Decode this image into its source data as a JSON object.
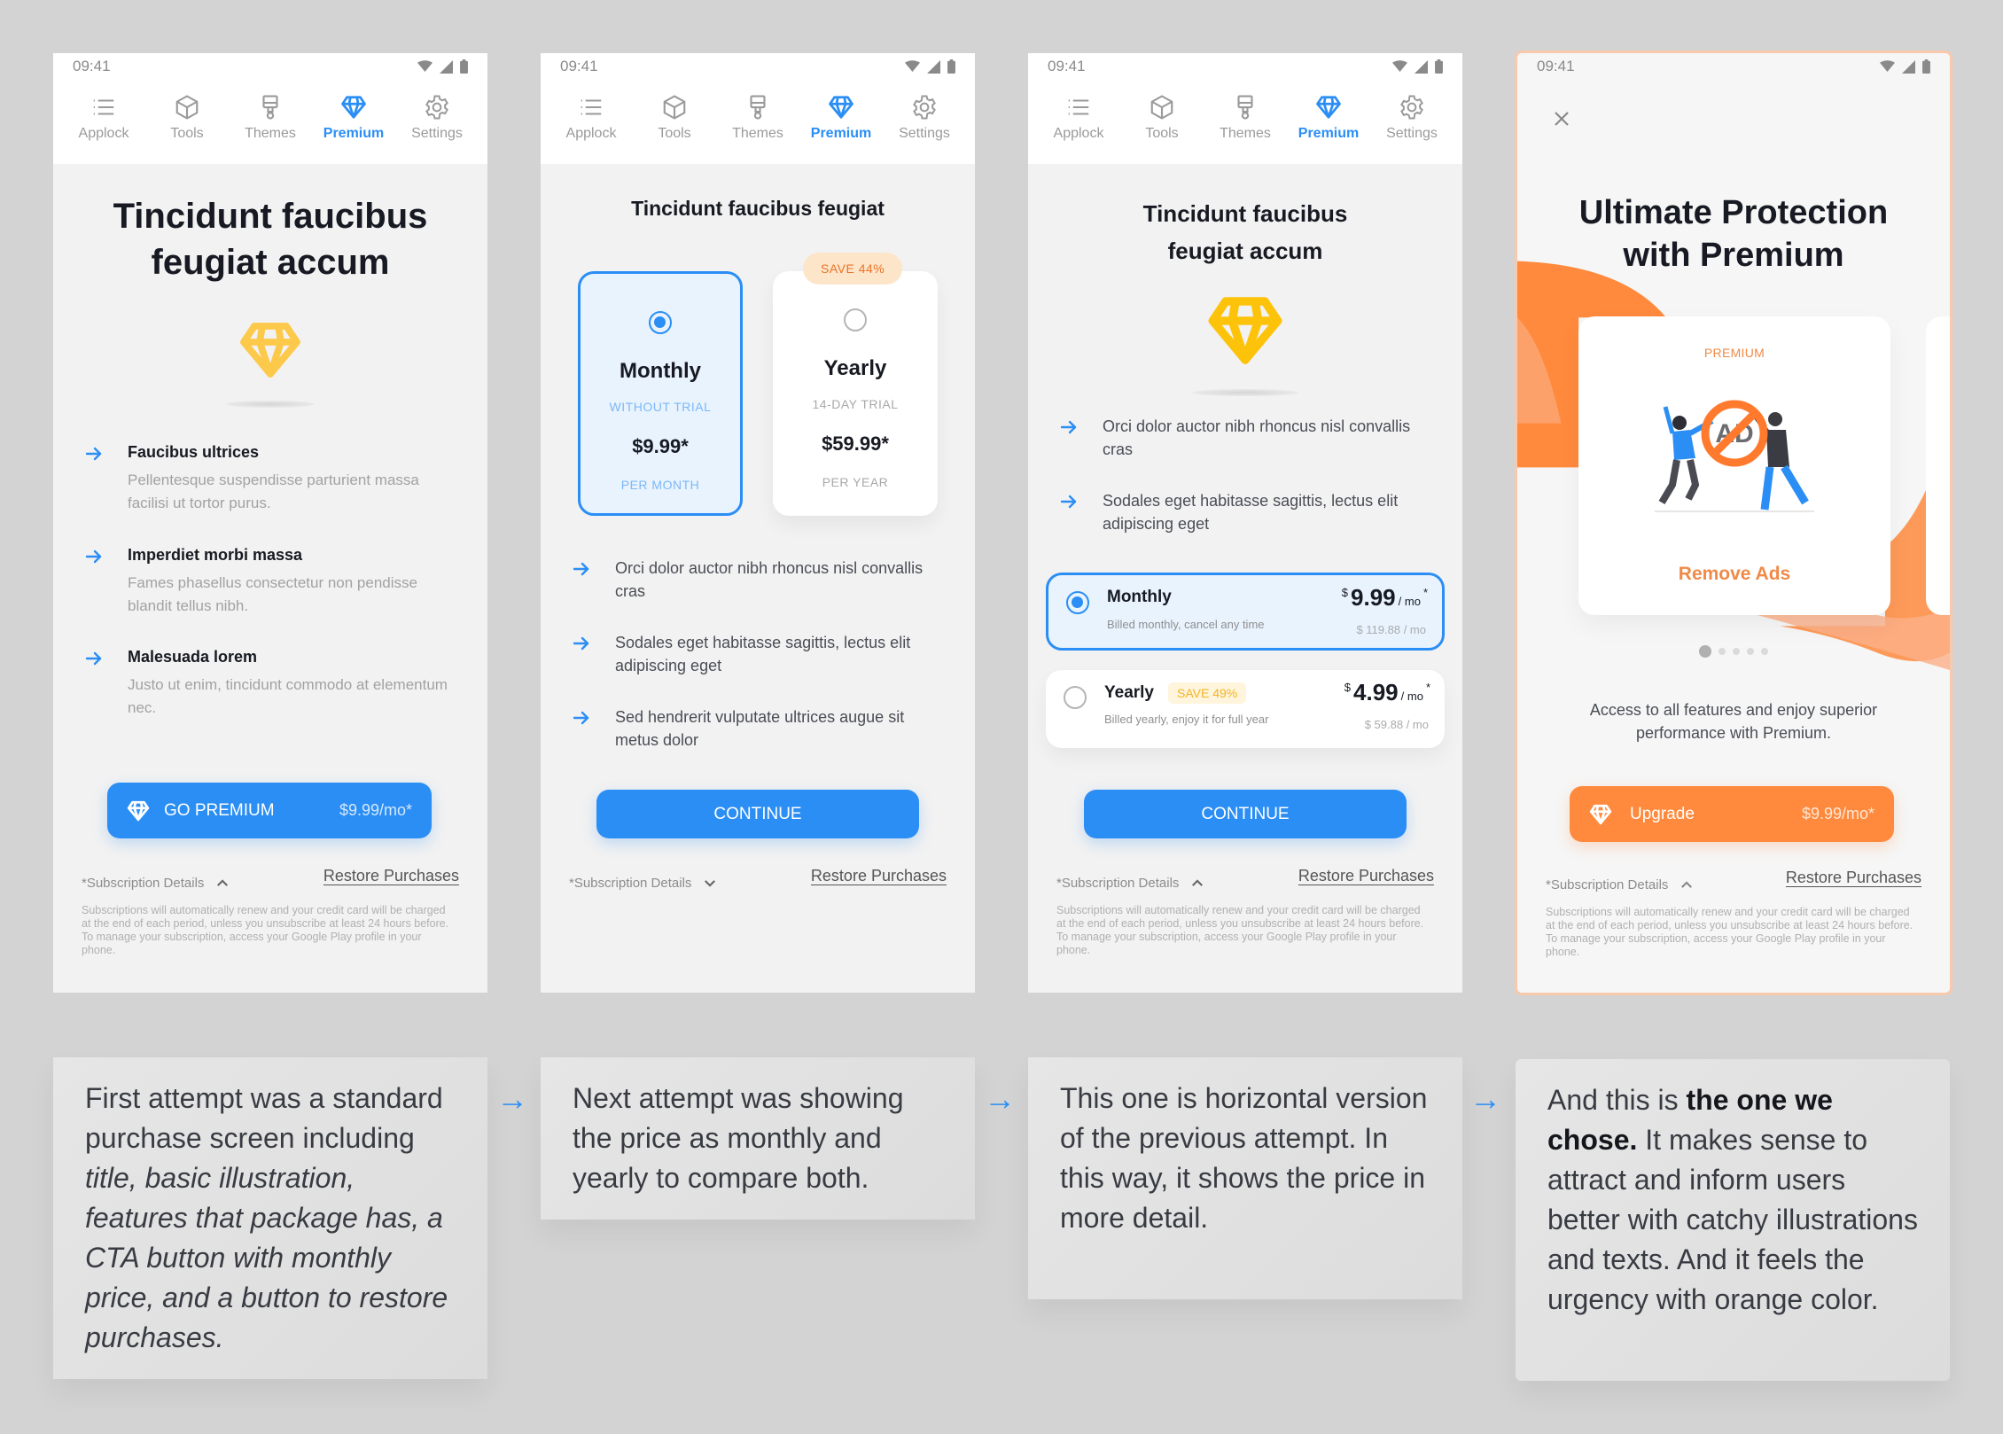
{
  "colors": {
    "accent_blue": "#2b8ef5",
    "accent_orange": "#ff8a3d",
    "gem_yellow": "#fdc30a",
    "background": "#d3d3d3"
  },
  "statusbar": {
    "time": "09:41",
    "icons": [
      "wifi-icon",
      "signal-icon",
      "battery-icon"
    ]
  },
  "nav_tabs": [
    {
      "label": "Applock",
      "icon": "list-icon"
    },
    {
      "label": "Tools",
      "icon": "cube-icon"
    },
    {
      "label": "Themes",
      "icon": "paint-brush-icon"
    },
    {
      "label": "Premium",
      "icon": "diamond-icon",
      "active": true
    },
    {
      "label": "Settings",
      "icon": "gear-icon"
    }
  ],
  "footer": {
    "subscription_details": "*Subscription Details",
    "restore_purchases": "Restore Purchases",
    "fineprint": "Subscriptions will automatically renew and your credit card will be charged at the end of each period, unless you unsubscribe at least 24 hours before. To manage your subscription, access your Google Play profile in your phone."
  },
  "screen1": {
    "title": "Tincidunt faucibus feugiat accum",
    "features": [
      {
        "title": "Faucibus ultrices",
        "desc": "Pellentesque suspendisse parturient massa facilisi ut tortor purus."
      },
      {
        "title": "Imperdiet morbi massa",
        "desc": "Fames phasellus consectetur non pendisse blandit tellus nibh."
      },
      {
        "title": "Malesuada lorem",
        "desc": "Justo ut enim, tincidunt commodo at elementum nec."
      }
    ],
    "cta_label": "GO PREMIUM",
    "cta_price": "$9.99/mo*",
    "details_expanded": true
  },
  "screen2": {
    "title": "Tincidunt faucibus feugiat",
    "plans": [
      {
        "name": "Monthly",
        "trial": "WITHOUT TRIAL",
        "price": "$9.99*",
        "period": "PER MONTH",
        "selected": true
      },
      {
        "name": "Yearly",
        "trial": "14-DAY TRIAL",
        "price": "$59.99*",
        "period": "PER YEAR",
        "selected": false,
        "badge": "SAVE 44%"
      }
    ],
    "features": [
      "Orci dolor auctor nibh rhoncus nisl convallis cras",
      "Sodales eget habitasse sagittis, lectus elit adipiscing eget",
      "Sed hendrerit vulputate ultrices augue sit metus dolor"
    ],
    "cta_label": "CONTINUE",
    "details_expanded": false
  },
  "screen3": {
    "title_line1": "Tincidunt faucibus",
    "title_line2": "feugiat accum",
    "features": [
      "Orci dolor auctor nibh rhoncus nisl convallis cras",
      "Sodales eget habitasse sagittis, lectus elit adipiscing eget"
    ],
    "plans": [
      {
        "name": "Monthly",
        "desc": "Billed monthly, cancel any time",
        "currency": "$",
        "price": "9.99",
        "unit": "/ mo",
        "asterisk": "*",
        "total": "$ 119.88 / mo",
        "selected": true
      },
      {
        "name": "Yearly",
        "badge": "SAVE 49%",
        "desc": "Billed yearly, enjoy it for full year",
        "currency": "$",
        "price": "4.99",
        "unit": "/ mo",
        "asterisk": "*",
        "total": "$ 59.88 / mo",
        "selected": false
      }
    ],
    "cta_label": "CONTINUE",
    "details_expanded": true
  },
  "screen4": {
    "title_line1": "Ultimate Protection",
    "title_line2": "with Premium",
    "card_label": "PREMIUM",
    "card_title": "Remove Ads",
    "illustration_text": "AD",
    "carousel": {
      "count": 5,
      "active": 1
    },
    "description": "Access to all features and enjoy superior performance with Premium.",
    "cta_label": "Upgrade",
    "cta_price": "$9.99/mo*",
    "details_expanded": true
  },
  "captions": {
    "c1": {
      "plain1": "First attempt was a standard purchase screen including ",
      "italic": "title, basic illustration, features that package has, a CTA button with monthly price, and a button to restore purchases."
    },
    "c2": "Next attempt was showing the price as monthly and yearly to compare both.",
    "c3": "This one is horizontal version of the previous attempt. In this way, it shows the price in more detail.",
    "c4": {
      "plain1": "And this is ",
      "bold": "the one we chose.",
      "plain2": " It makes sense to attract and inform users better with catchy illustrations and texts. And it feels the urgency with orange color."
    }
  },
  "flow_arrow": "→"
}
